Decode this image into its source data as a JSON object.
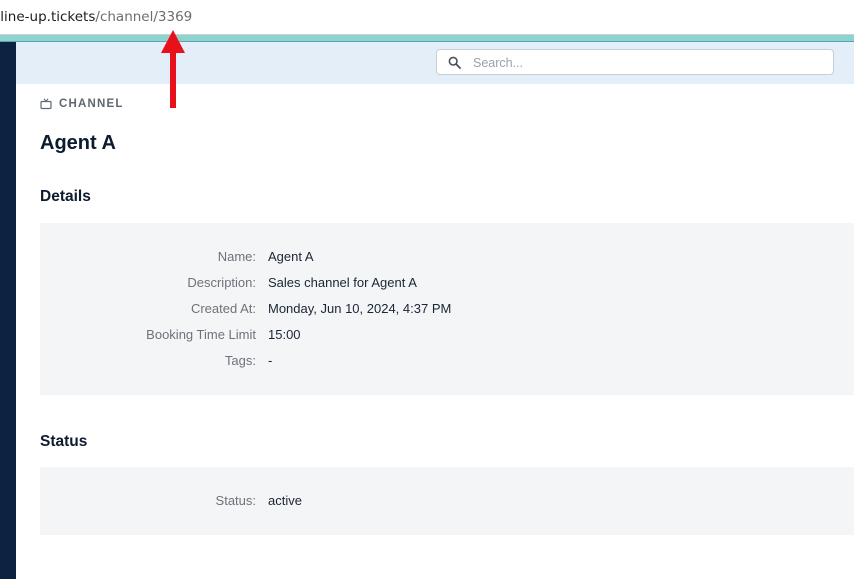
{
  "browser": {
    "url_domain": ".line-up.tickets",
    "url_path": "/channel/3369"
  },
  "search": {
    "placeholder": "Search..."
  },
  "page": {
    "section_label": "CHANNEL",
    "title": "Agent A"
  },
  "details": {
    "heading": "Details",
    "rows": [
      {
        "label": "Name:",
        "value": "Agent A"
      },
      {
        "label": "Description:",
        "value": "Sales channel for Agent A"
      },
      {
        "label": "Created At:",
        "value": "Monday, Jun 10, 2024, 4:37 PM"
      },
      {
        "label": "Booking Time Limit",
        "value": "15:00"
      },
      {
        "label": "Tags:",
        "value": "-"
      }
    ]
  },
  "status": {
    "heading": "Status",
    "rows": [
      {
        "label": "Status:",
        "value": "active"
      }
    ]
  },
  "colors": {
    "sidebar": "#0b2240",
    "accent_bar": "#8fd2d0",
    "top_strip": "#e4eef8",
    "panel_bg": "#f4f5f6",
    "annotation_arrow": "#e8101a"
  },
  "icons": {
    "search": "magnifier-icon",
    "section": "tv-icon",
    "annotation": "red-arrow-up"
  }
}
